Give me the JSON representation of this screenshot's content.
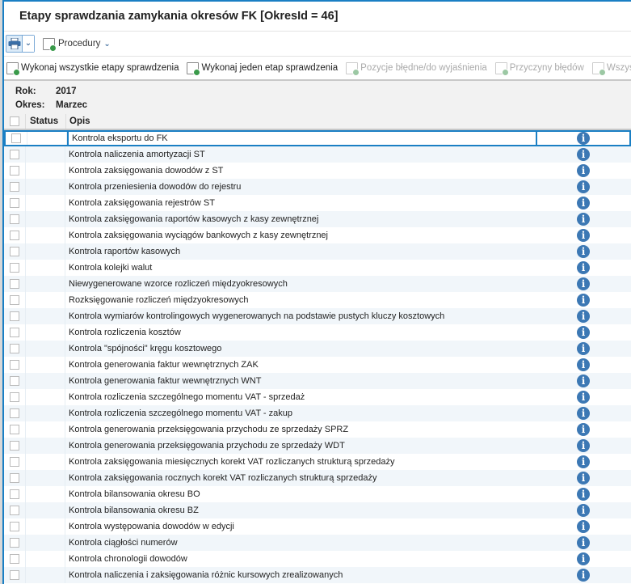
{
  "window": {
    "title": "Etapy sprawdzania zamykania okresów FK [OkresId = 46]"
  },
  "toolbar": {
    "print_icon": "printer-icon",
    "procedury_label": "Procedury"
  },
  "actions": [
    {
      "label": "Wykonaj wszystkie etapy sprawdzenia",
      "enabled": true
    },
    {
      "label": "Wykonaj jeden etap sprawdzenia",
      "enabled": true
    },
    {
      "label": "Pozycje błędne/do wyjaśnienia",
      "enabled": false
    },
    {
      "label": "Przyczyny błędów",
      "enabled": false
    },
    {
      "label": "Wszystkie",
      "enabled": false
    }
  ],
  "info": {
    "rok_label": "Rok:",
    "rok_value": "2017",
    "okres_label": "Okres:",
    "okres_value": "Marzec"
  },
  "grid": {
    "columns": {
      "status": "Status",
      "opis": "Opis"
    },
    "selected_index": 0,
    "rows": [
      "Kontrola eksportu do FK",
      "Kontrola naliczenia amortyzacji ST",
      "Kontrola zaksięgowania dowodów z ST",
      "Kontrola przeniesienia dowodów do rejestru",
      "Kontrola zaksięgowania rejestrów ST",
      "Kontrola zaksięgowania raportów kasowych z kasy zewnętrznej",
      "Kontrola zaksięgowania wyciągów bankowych z kasy zewnętrznej",
      "Kontrola raportów kasowych",
      "Kontrola kolejki walut",
      "Niewygenerowane wzorce rozliczeń międzyokresowych",
      "Rozksięgowanie rozliczeń międzyokresowych",
      "Kontrola wymiarów kontrolingowych wygenerowanych na podstawie pustych kluczy kosztowych",
      "Kontrola rozliczenia kosztów",
      "Kontrola \"spójności\" kręgu kosztowego",
      "Kontrola generowania faktur wewnętrznych ZAK",
      "Kontrola generowania faktur wewnętrznych WNT",
      "Kontrola rozliczenia szczególnego momentu VAT - sprzedaż",
      "Kontrola rozliczenia szczególnego momentu VAT - zakup",
      "Kontrola generowania przeksięgowania przychodu ze sprzedaży SPRZ",
      "Kontrola generowania przeksięgowania przychodu ze sprzedaży WDT",
      "Kontrola zaksięgowania miesięcznych korekt VAT rozliczanych strukturą sprzedaży",
      "Kontrola zaksięgowania rocznych korekt VAT rozliczanych strukturą sprzedaży",
      "Kontrola bilansowania okresu BO",
      "Kontrola bilansowania okresu BZ",
      "Kontrola występowania dowodów w edycji",
      "Kontrola ciągłości numerów",
      "Kontrola chronologii dowodów",
      "Kontrola naliczenia i zaksięgowania różnic kursowych zrealizowanych"
    ]
  }
}
